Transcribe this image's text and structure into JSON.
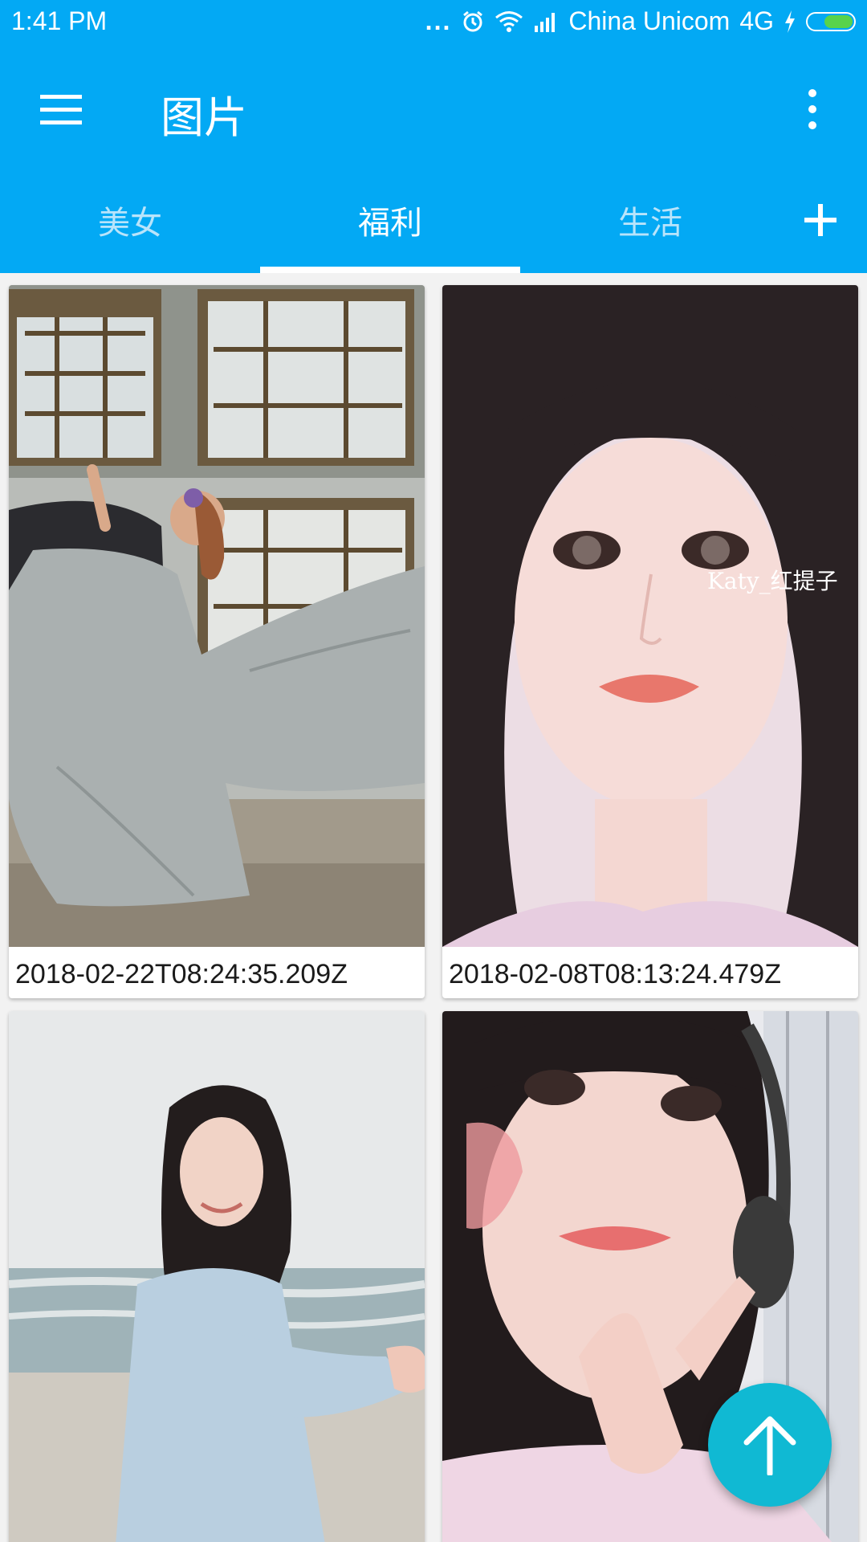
{
  "status_bar": {
    "time": "1:41 PM",
    "dots": "...",
    "carrier": "China Unicom",
    "network": "4G",
    "battery_level": 0.65
  },
  "app_bar": {
    "title": "图片",
    "menu_icon": "hamburger-menu-icon",
    "overflow_icon": "more-vertical-icon"
  },
  "tabs": [
    {
      "label": "美女",
      "active": false
    },
    {
      "label": "福利",
      "active": true
    },
    {
      "label": "生活",
      "active": false
    }
  ],
  "add_tab_icon": "plus-icon",
  "cards": [
    {
      "caption": "2018-02-22T08:24:35.209Z",
      "image": "photo-woman-in-gown"
    },
    {
      "caption": "2018-02-08T08:13:24.479Z",
      "image": "photo-portrait-closeup",
      "watermark": "Katy_红提子"
    },
    {
      "caption": "",
      "image": "photo-woman-at-beach"
    },
    {
      "caption": "",
      "image": "photo-woman-with-headphones"
    }
  ],
  "fab": {
    "icon": "arrow-up-icon"
  },
  "colors": {
    "primary": "#03a9f4",
    "fab": "#10b9d3",
    "tab_inactive": "#b8e4fb"
  }
}
